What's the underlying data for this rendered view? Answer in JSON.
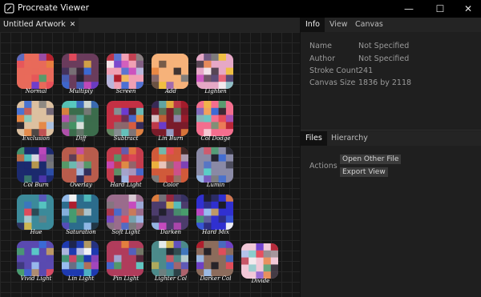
{
  "window": {
    "title": "Procreate Viewer",
    "minimize_glyph": "—",
    "maximize_glyph": "☐",
    "close_glyph": "✕"
  },
  "document": {
    "tab_label": "Untitled Artwork",
    "tab_close_glyph": "✕"
  },
  "thumbnails": [
    {
      "label": "Normal",
      "color": "#e86a5a"
    },
    {
      "label": "Multiply",
      "color": "#6a3c5c"
    },
    {
      "label": "Screen",
      "color": "#f0a0b4"
    },
    {
      "label": "Add",
      "color": "#f6b27a"
    },
    {
      "label": "Lighten",
      "color": "#e6a8c6"
    },
    {
      "label": "Exclusion",
      "color": "#dcc0a0"
    },
    {
      "label": "Diff",
      "color": "#3c6c4c"
    },
    {
      "label": "Subtract",
      "color": "#c43044"
    },
    {
      "label": "Lin Burn",
      "color": "#7a1c2a"
    },
    {
      "label": "Col Dodge",
      "color": "#f46e8e"
    },
    {
      "label": "Col Burn",
      "color": "#1c2a6e"
    },
    {
      "label": "Overlay",
      "color": "#b85c4c"
    },
    {
      "label": "Hard Light",
      "color": "#c43c4c"
    },
    {
      "label": "Color",
      "color": "#d05a3a"
    },
    {
      "label": "Lumin",
      "color": "#8a8aa6"
    },
    {
      "label": "Hue",
      "color": "#3c8a9a"
    },
    {
      "label": "Saturation",
      "color": "#2c6c8c"
    },
    {
      "label": "Soft Light",
      "color": "#9a6c8c"
    },
    {
      "label": "Darken",
      "color": "#4c3c6c"
    },
    {
      "label": "Hard Mix",
      "color": "#3030d0"
    },
    {
      "label": "Vivid Light",
      "color": "#5a4ab0"
    },
    {
      "label": "Lin Light",
      "color": "#1e3ab0"
    },
    {
      "label": "Pin Light",
      "color": "#b03c5c"
    },
    {
      "label": "Lighter Col",
      "color": "#4c8a8a"
    },
    {
      "label": "Darker Col",
      "color": "#8c6c5c"
    },
    {
      "label": "Divide",
      "color": "#f2c8d8"
    }
  ],
  "panel_top": {
    "tabs": [
      "Info",
      "View",
      "Canvas"
    ],
    "active_tab": "Info",
    "properties": [
      {
        "name": "Name",
        "value": "Not Specified"
      },
      {
        "name": "Author",
        "value": "Not Specified"
      },
      {
        "name": "Stroke Count",
        "value": "241"
      },
      {
        "name": "Canvas Size",
        "value": "1836 by 2118"
      }
    ]
  },
  "panel_bottom": {
    "tabs": [
      "Files",
      "Hierarchy"
    ],
    "active_tab": "Files",
    "actions_label": "Actions",
    "buttons": [
      "Open Other File",
      "Export View"
    ]
  }
}
